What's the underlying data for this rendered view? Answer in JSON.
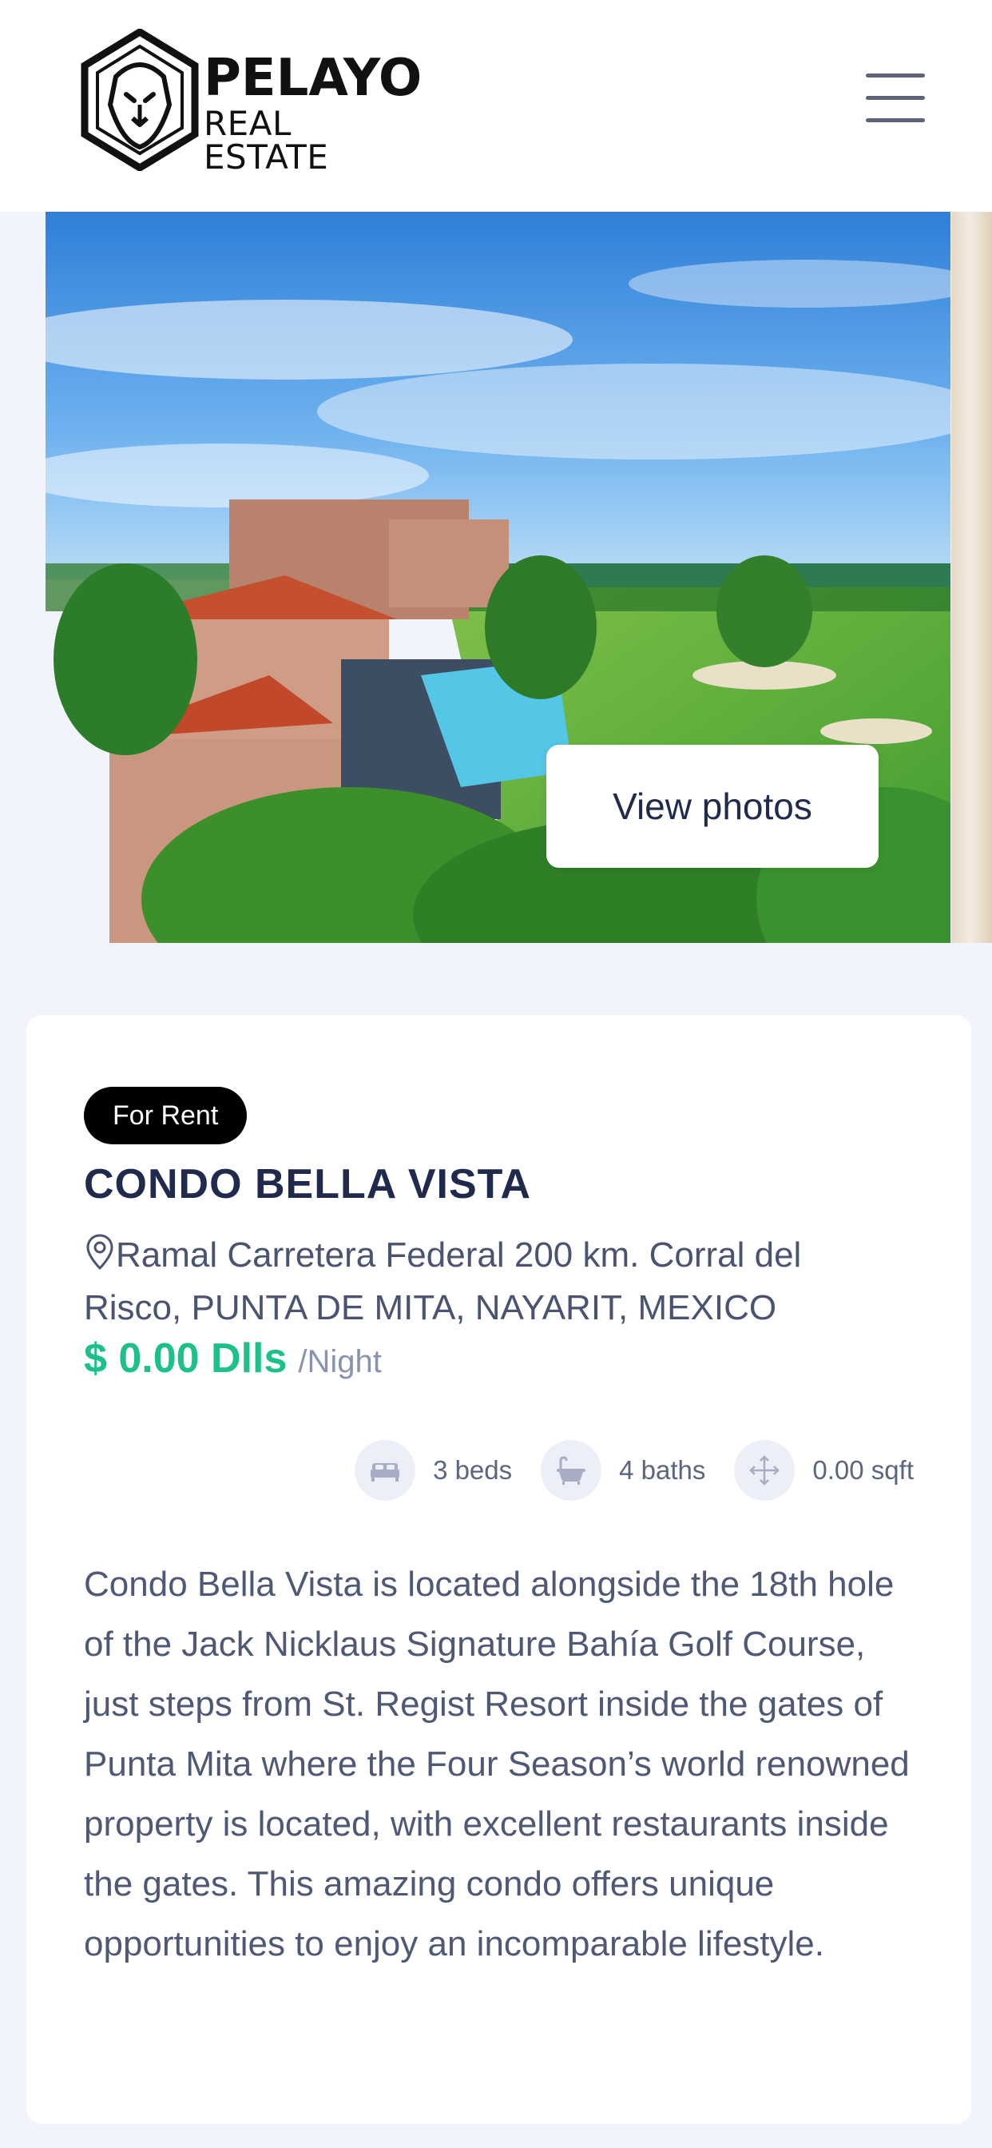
{
  "header": {
    "brand_top": "PELAYO",
    "brand_bottom": "REAL ESTATE",
    "menu_icon": "hamburger-menu-icon"
  },
  "gallery": {
    "view_photos_label": "View photos"
  },
  "listing": {
    "status_badge": "For Rent",
    "title": "CONDO BELLA VISTA",
    "address": "Ramal Carretera Federal 200 km. Corral del Risco, PUNTA DE MITA, NAYARIT, MEXICO",
    "price": "$ 0.00 Dlls",
    "price_unit": "/Night",
    "features": {
      "beds": "3 beds",
      "baths": "4 baths",
      "area": "0.00 sqft"
    },
    "description": "Condo Bella Vista is located alongside the 18th hole of the Jack Nicklaus Signature Bahía Golf Course, just steps from St. Regist Resort inside the gates of Punta Mita where the Four Season’s world renowned property is located, with excellent restaurants inside the gates. This amazing condo offers unique opportunities to enjoy an incomparable lifestyle."
  },
  "colors": {
    "navy": "#1f2a4d",
    "price_green": "#1dbf8a",
    "page_bg": "#f1f4fb",
    "badge_bg": "#000000"
  }
}
